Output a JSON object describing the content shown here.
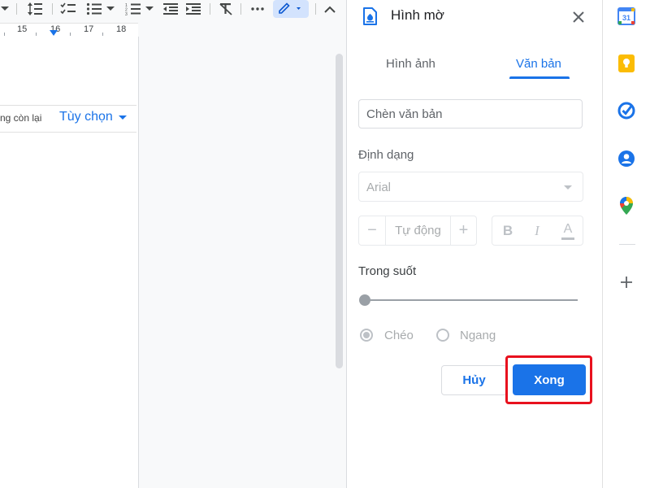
{
  "toolbar": {
    "icons": [
      "line-spacing-icon",
      "checklist-icon",
      "bulleted-list-icon",
      "numbered-list-icon",
      "decrease-indent-icon",
      "increase-indent-icon",
      "clear-formatting-icon",
      "more-icon",
      "edit-mode-icon",
      "collapse-icon"
    ]
  },
  "ruler": {
    "ticks": [
      "15",
      "16",
      "17",
      "18"
    ]
  },
  "document": {
    "remaining_text": "ng còn lại",
    "options_label": "Tùy chọn"
  },
  "panel": {
    "title": "Hình mờ",
    "close_icon": "close-icon",
    "tabs": {
      "image": "Hình ảnh",
      "text": "Văn bản"
    },
    "text_input_placeholder": "Chèn văn bản",
    "format_label": "Định dạng",
    "font_value": "Arial",
    "size_value": "Tự động",
    "minus": "−",
    "plus": "+",
    "bold": "B",
    "italic": "I",
    "text_color": "A",
    "opacity_label": "Trong suốt",
    "opacity_value": 0,
    "orientation": {
      "diagonal": "Chéo",
      "horizontal": "Ngang",
      "selected": "diagonal"
    },
    "cancel_label": "Hủy",
    "done_label": "Xong"
  },
  "rail": {
    "calendar_day": "31",
    "add": "+"
  },
  "colors": {
    "accent": "#1a73e8",
    "highlight": "#e8111e"
  }
}
